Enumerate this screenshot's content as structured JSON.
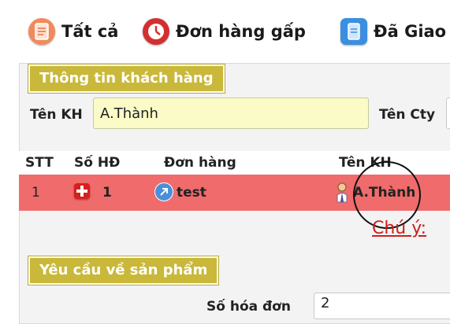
{
  "toolbar": {
    "items": [
      {
        "label": "Tất cả",
        "icon": "document-icon",
        "color": "#f08a5d"
      },
      {
        "label": "Đơn hàng gấp",
        "icon": "clock-icon",
        "color": "#d32f2f"
      },
      {
        "label": "Đã Giao",
        "icon": "file-icon",
        "color": "#3b8fe0"
      }
    ]
  },
  "customer_section": {
    "title": "Thông tin khách hàng",
    "name_label": "Tên KH",
    "name_value": "A.Thành",
    "company_label": "Tên Cty"
  },
  "table": {
    "headers": [
      "STT",
      "Số HĐ",
      "Đơn hàng",
      "Tên KH"
    ],
    "rows": [
      {
        "stt": "1",
        "invoice": "1",
        "order": "test",
        "customer": "A.Thành"
      }
    ],
    "highlight_color": "#f06b6b"
  },
  "note_label": "Chú ý:",
  "product_section": {
    "title": "Yêu cầu về sản phẩm",
    "invoice_label": "Số hóa đơn",
    "invoice_value": "2"
  }
}
